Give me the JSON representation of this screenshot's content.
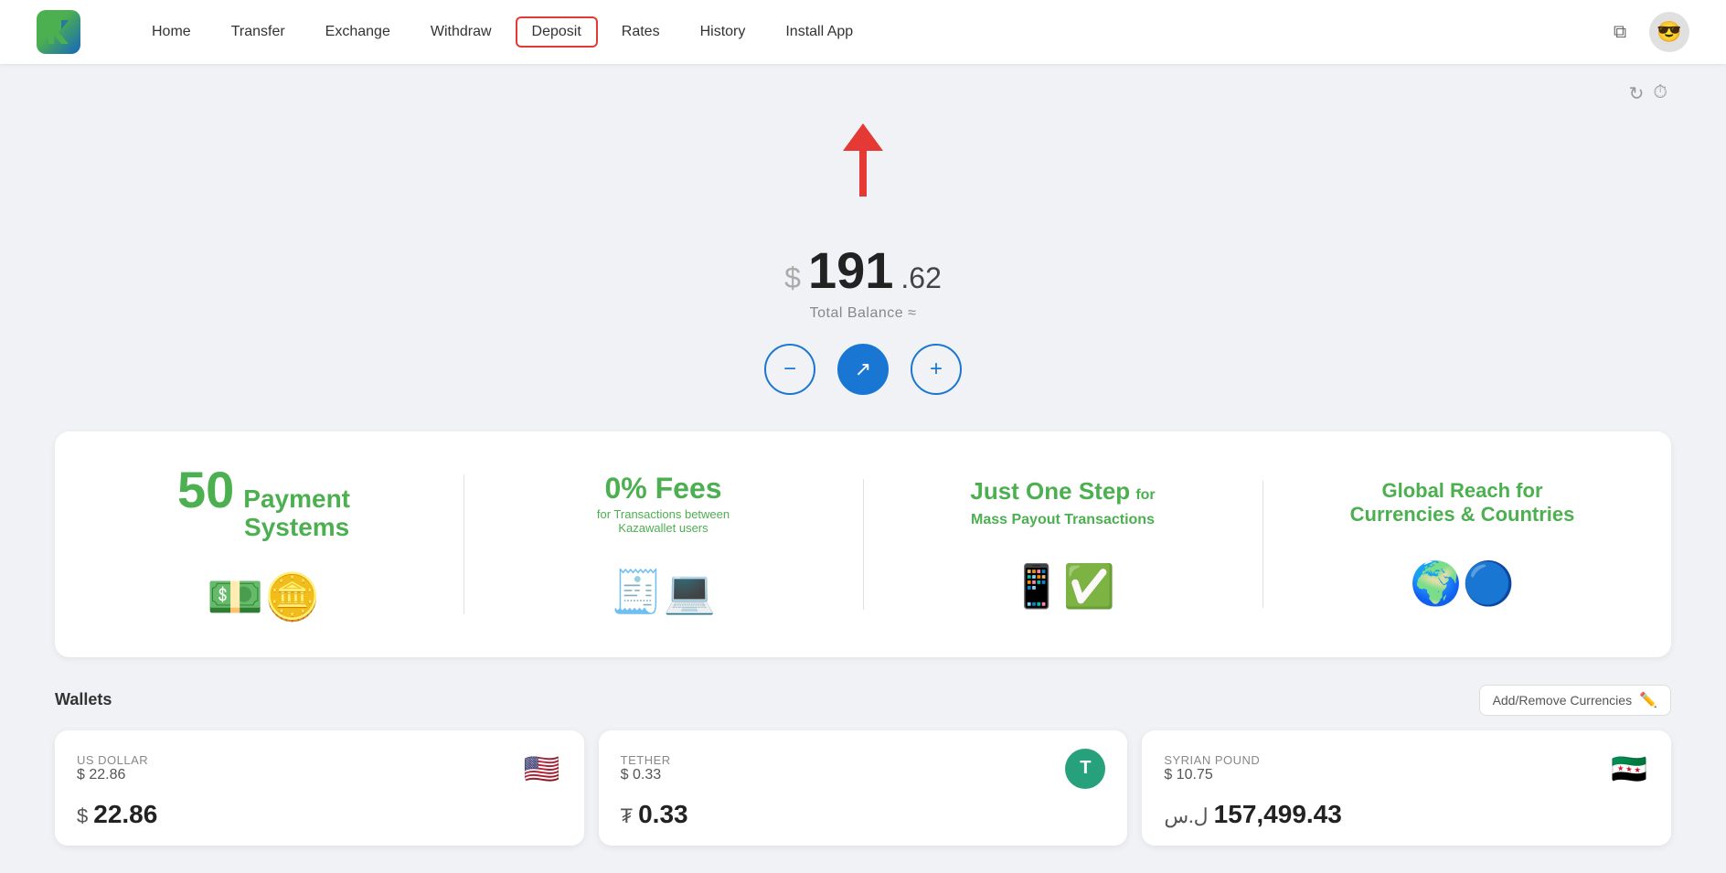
{
  "logo": {
    "text": "K",
    "alt": "KazaWallet Logo"
  },
  "nav": {
    "items": [
      {
        "id": "home",
        "label": "Home",
        "active": false
      },
      {
        "id": "transfer",
        "label": "Transfer",
        "active": false
      },
      {
        "id": "exchange",
        "label": "Exchange",
        "active": false
      },
      {
        "id": "withdraw",
        "label": "Withdraw",
        "active": false
      },
      {
        "id": "deposit",
        "label": "Deposit",
        "active": true
      },
      {
        "id": "rates",
        "label": "Rates",
        "active": false
      },
      {
        "id": "history",
        "label": "History",
        "active": false
      },
      {
        "id": "install_app",
        "label": "Install App",
        "active": false
      }
    ]
  },
  "balance": {
    "currency_sign": "$",
    "amount_whole": "191",
    "amount_decimal": ".62",
    "label": "Total Balance ≈"
  },
  "action_buttons": [
    {
      "id": "withdraw",
      "icon": "−",
      "filled": false,
      "label": "Withdraw"
    },
    {
      "id": "transfer",
      "icon": "↗",
      "filled": true,
      "label": "Transfer"
    },
    {
      "id": "deposit",
      "icon": "+",
      "filled": false,
      "label": "Deposit"
    }
  ],
  "banners": [
    {
      "id": "payment-systems",
      "big_number": "50",
      "title": "Payment\nSystems",
      "subtitle": "",
      "emoji": "💵"
    },
    {
      "id": "zero-fees",
      "title": "0% Fees",
      "subtitle": "for Transactions between\nKazawallet users",
      "emoji": "🧾"
    },
    {
      "id": "one-step",
      "title": "Just One Step",
      "title_suffix": "for\nMass Payout Transactions",
      "emoji": "📱"
    },
    {
      "id": "global-reach",
      "title": "Global Reach for\nCurrencies & Countries",
      "emoji": "🌍"
    }
  ],
  "wallets": {
    "title": "Wallets",
    "add_remove_label": "Add/Remove Currencies",
    "cards": [
      {
        "id": "usd",
        "currency_name": "US DOLLAR",
        "usd_value": "$ 22.86",
        "amount": "22.86",
        "symbol": "$",
        "flag_emoji": "🇺🇸",
        "flag_color": "#fff"
      },
      {
        "id": "tether",
        "currency_name": "TETHER",
        "usd_value": "$ 0.33",
        "amount": "0.33",
        "symbol": "₮",
        "flag_emoji": "T",
        "flag_bg": "#26A17B"
      },
      {
        "id": "syp",
        "currency_name": "SYRIAN POUND",
        "usd_value": "$ 10.75",
        "amount": "157,499.43",
        "symbol": "ل.س",
        "flag_emoji": "🇸🇾",
        "flag_color": "#fff"
      }
    ]
  },
  "icons": {
    "refresh": "↻",
    "history": "⏱",
    "copy": "⧉",
    "edit": "✏"
  }
}
